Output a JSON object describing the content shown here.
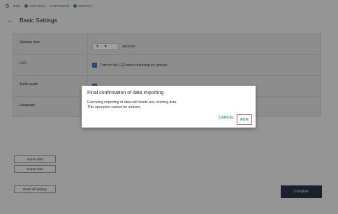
{
  "status_bar": {
    "items": [
      {
        "label": "NOS",
        "dot": false
      },
      {
        "label": "NOS-0011",
        "dot": true
      },
      {
        "label": "CARTRIDGE",
        "dot": false
      },
      {
        "label": "123TEST",
        "dot": true
      }
    ]
  },
  "header": {
    "back_icon": "arrow-left-icon",
    "title": "Basic Settings"
  },
  "settings": {
    "release_time": {
      "label": "Release time",
      "value": "4",
      "unit": "seconds"
    },
    "led": {
      "label": "LED",
      "checkbox_label": "Turn on the LED when releasing an amount",
      "checked": true
    },
    "audio_guide": {
      "label": "Audio guide",
      "checked": true
    },
    "language": {
      "label": "Language"
    }
  },
  "buttons": {
    "import": "Import data",
    "export": "Export data",
    "reset": "Reset all settings",
    "complete": "Complete"
  },
  "dialog": {
    "title": "Final confirmation of data importing",
    "line1": "Executing importing of data will delete any existing data.",
    "line2": "This operation cannot be undone.",
    "cancel": "CANCEL",
    "run": "RUN"
  },
  "colors": {
    "accent_green": "#2e9e48",
    "checkbox_blue": "#2a6fc4",
    "complete_bg": "#2a3547",
    "run_border": "#d75070"
  }
}
